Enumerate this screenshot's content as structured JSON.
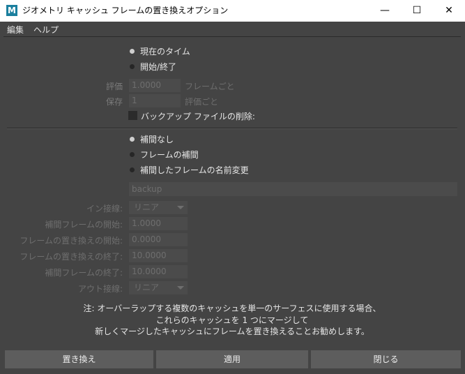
{
  "window": {
    "app_icon_letter": "M",
    "title": "ジオメトリ キャッシュ フレームの置き換えオプション",
    "minimize_glyph": "—",
    "maximize_glyph": "☐",
    "close_glyph": "✕"
  },
  "menu": [
    "編集",
    "ヘルプ"
  ],
  "time_mode": {
    "options": [
      "現在のタイム",
      "開始/終了"
    ],
    "selected_index": 0
  },
  "evaluate": {
    "label": "評価",
    "value": "1.0000",
    "suffix": "フレームごと"
  },
  "save": {
    "label": "保存",
    "value": "1",
    "suffix": "評価ごと"
  },
  "delete_backup": {
    "label": "バックアップ ファイルの削除:",
    "checked": false
  },
  "interp_mode": {
    "options": [
      "補間なし",
      "フレームの補間",
      "補間したフレームの名前変更"
    ],
    "selected_index": 0
  },
  "rename_field": {
    "placeholder": "backup"
  },
  "in_tangent": {
    "label": "イン接線:",
    "value": "リニア"
  },
  "interp_start": {
    "label": "補間フレームの開始:",
    "value": "1.0000"
  },
  "replace_start": {
    "label": "フレームの置き換えの開始:",
    "value": "0.0000"
  },
  "replace_end": {
    "label": "フレームの置き換えの終了:",
    "value": "10.0000"
  },
  "interp_end": {
    "label": "補間フレームの終了:",
    "value": "10.0000"
  },
  "out_tangent": {
    "label": "アウト接線:",
    "value": "リニア"
  },
  "note": {
    "line1": "注: オーバーラップする複数のキャッシュを単一のサーフェスに使用する場合、",
    "line2": "これらのキャッシュを 1 つにマージして",
    "line3": "新しくマージしたキャッシュにフレームを置き換えることお勧めします。"
  },
  "buttons": {
    "replace": "置き換え",
    "apply": "適用",
    "close": "閉じる"
  }
}
